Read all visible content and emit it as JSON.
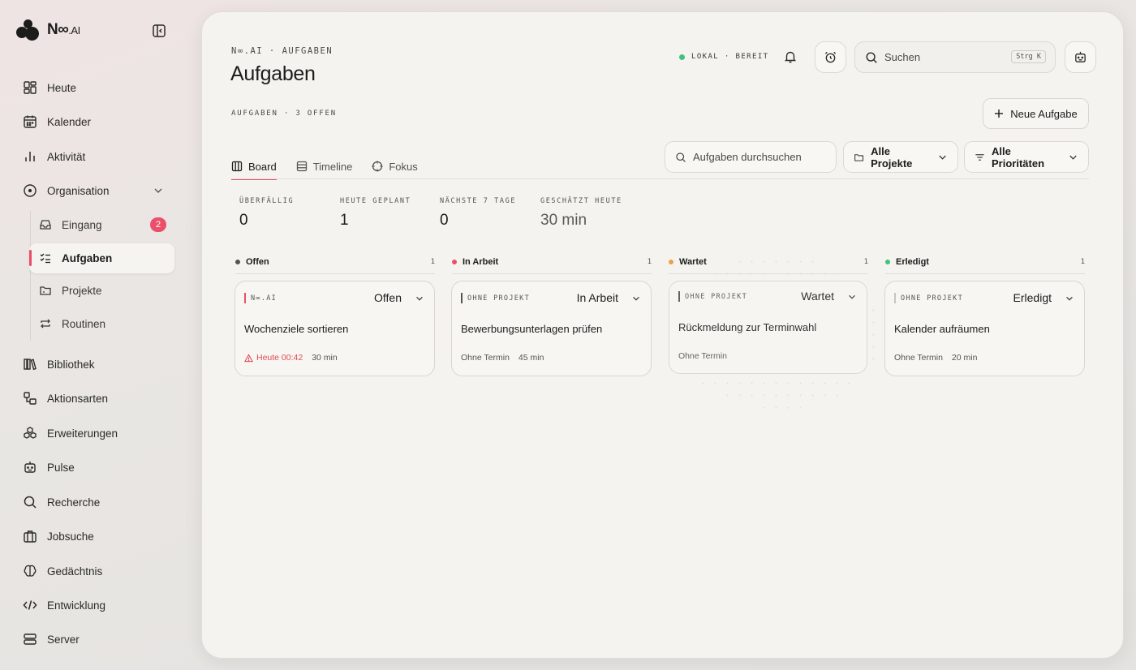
{
  "brand": {
    "name": "N∞",
    "suffix": ".AI"
  },
  "sidebar": {
    "items": [
      {
        "label": "Heute"
      },
      {
        "label": "Kalender"
      },
      {
        "label": "Aktivität"
      },
      {
        "label": "Organisation"
      },
      {
        "label": "Bibliothek"
      },
      {
        "label": "Aktionsarten"
      },
      {
        "label": "Erweiterungen"
      },
      {
        "label": "Pulse"
      },
      {
        "label": "Recherche"
      },
      {
        "label": "Jobsuche"
      },
      {
        "label": "Gedächtnis"
      },
      {
        "label": "Entwicklung"
      },
      {
        "label": "Server"
      }
    ],
    "sub_items": [
      {
        "label": "Eingang",
        "badge": "2"
      },
      {
        "label": "Aufgaben"
      },
      {
        "label": "Projekte"
      },
      {
        "label": "Routinen"
      }
    ]
  },
  "header": {
    "breadcrumb": "N∞.AI · AUFGABEN",
    "title": "Aufgaben",
    "subcount": "AUFGABEN · 3 OFFEN",
    "status": "LOKAL · BEREIT",
    "search_placeholder": "Suchen",
    "search_shortcut": "Strg K",
    "new_task": "Neue Aufgabe"
  },
  "tabs": [
    {
      "label": "Board"
    },
    {
      "label": "Timeline"
    },
    {
      "label": "Fokus"
    }
  ],
  "filters": {
    "search_placeholder": "Aufgaben durchsuchen",
    "projects": "Alle Projekte",
    "priorities": "Alle Prioritäten"
  },
  "stats": [
    {
      "label": "ÜBERFÄLLIG",
      "value": "0"
    },
    {
      "label": "HEUTE GEPLANT",
      "value": "1"
    },
    {
      "label": "NÄCHSTE 7 TAGE",
      "value": "0"
    },
    {
      "label": "GESCHÄTZT HEUTE",
      "value": "30 min"
    }
  ],
  "columns": [
    {
      "title": "Offen",
      "count": "1",
      "color": "#55554f"
    },
    {
      "title": "In Arbeit",
      "count": "1",
      "color": "#e8506a"
    },
    {
      "title": "Wartet",
      "count": "1",
      "color": "#e9a24a"
    },
    {
      "title": "Erledigt",
      "count": "1",
      "color": "#3ec47a"
    }
  ],
  "cards": [
    {
      "project": "N∞.AI",
      "state": "Offen",
      "title": "Wochenziele sortieren",
      "due": "Heute 00:42",
      "duration": "30 min",
      "accent": "#e8506a"
    },
    {
      "project": "OHNE PROJEKT",
      "state": "In Arbeit",
      "title": "Bewerbungsunterlagen prüfen",
      "due": "Ohne Termin",
      "duration": "45 min",
      "accent": "#55554f"
    },
    {
      "project": "OHNE PROJEKT",
      "state": "Wartet",
      "title": "Rückmeldung zur Terminwahl",
      "due": "Ohne Termin",
      "duration": "",
      "accent": "#55554f"
    },
    {
      "project": "OHNE PROJEKT",
      "state": "Erledigt",
      "title": "Kalender aufräumen",
      "due": "Ohne Termin",
      "duration": "20 min",
      "accent": "#c9c6c1"
    }
  ]
}
